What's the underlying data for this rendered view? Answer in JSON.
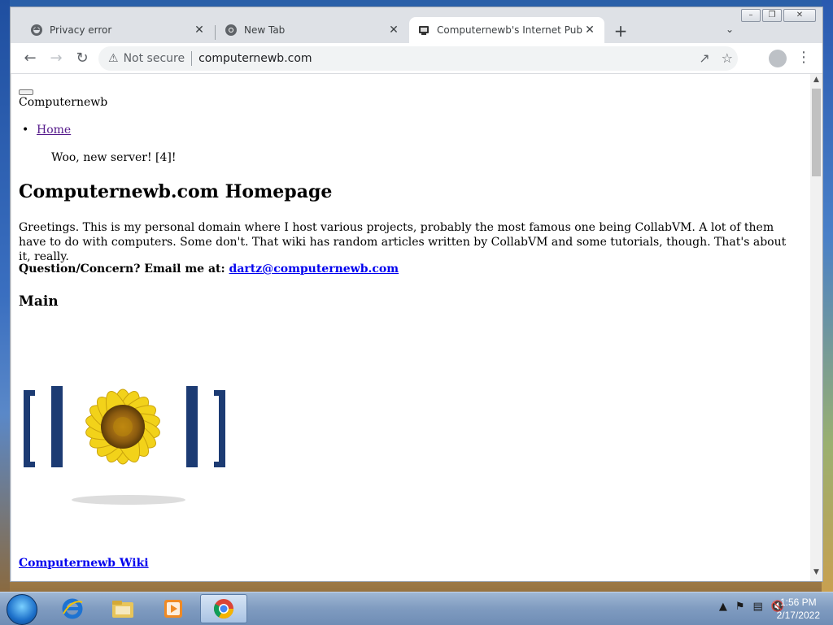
{
  "browser": {
    "tabs": [
      {
        "title": "Privacy error",
        "active": false,
        "icon": "warning-globe-icon"
      },
      {
        "title": "New Tab",
        "active": false,
        "icon": "chrome-icon"
      },
      {
        "title": "Computernewb's Internet Pub Hub",
        "active": true,
        "icon": "site-favicon"
      }
    ],
    "new_tab_label": "+",
    "omnibox": {
      "security_label": "Not secure",
      "url": "computernewb.com"
    }
  },
  "page": {
    "brand": "Computernewb",
    "nav": [
      {
        "label": "Home"
      }
    ],
    "news": "Woo, new server! [4]!",
    "title": "Computernewb.com Homepage",
    "greeting": "Greetings. This is my personal domain where I host various projects, probably the most famous one being CollabVM. A lot of them have to do with computers. Some don't. That wiki has random articles written by CollabVM and some tutorials, though. That's about it, really.",
    "contact_prefix": "Question/Concern? Email me at:",
    "contact_email": "dartz@computernewb.com",
    "section_heading": "Main",
    "wiki_link": "Computernewb Wiki"
  },
  "taskbar": {
    "apps": [
      {
        "name": "internet-explorer"
      },
      {
        "name": "file-explorer"
      },
      {
        "name": "media-player"
      },
      {
        "name": "chrome",
        "active": true
      }
    ],
    "time": "1:56 PM",
    "date": "2/17/2022"
  },
  "colors": {
    "link_visited": "#551a8b",
    "link": "#0000ee",
    "tab_strip": "#dee1e6"
  }
}
